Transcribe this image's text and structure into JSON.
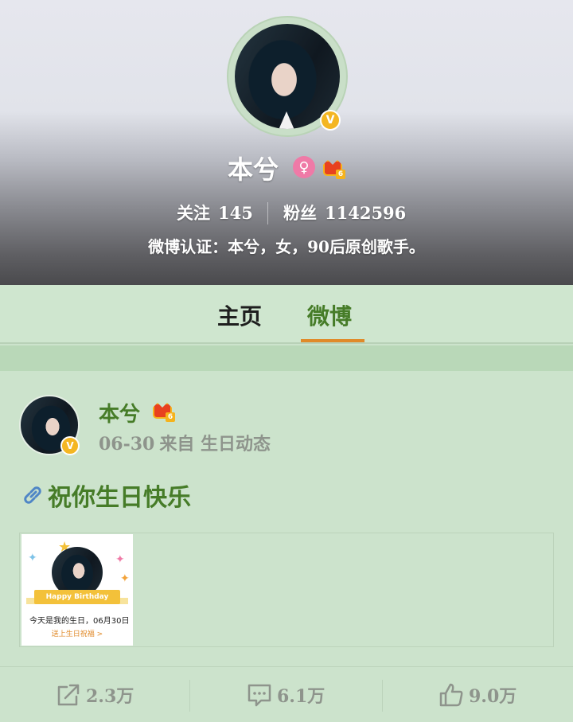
{
  "profile": {
    "name": "本兮",
    "crown_level": "6",
    "follow_label": "关注",
    "follow_count": "145",
    "fans_label": "粉丝",
    "fans_count": "1142596",
    "verification": "微博认证：本兮，女，90后原创歌手。",
    "verified_mark": "V",
    "gender_symbol": "♀"
  },
  "tabs": [
    {
      "label": "主页",
      "active": false
    },
    {
      "label": "微博",
      "active": true
    }
  ],
  "post": {
    "author": "本兮",
    "crown_level": "6",
    "date": "06-30",
    "source": "来自 生日动态",
    "text": "祝你生日快乐",
    "card": {
      "ribbon": "Happy Birthday",
      "line1": "今天是我的生日，06月30日",
      "line2": "送上生日祝福 >"
    }
  },
  "actions": {
    "repost_count": "2.3万",
    "comment_count": "6.1万",
    "like_count": "9.0万"
  },
  "colors": {
    "accent_green": "#467c28",
    "tab_underline": "#e08a29",
    "verified_badge": "#f4b622",
    "gender_badge": "#ef7aa7",
    "background": "#cce3cc"
  }
}
